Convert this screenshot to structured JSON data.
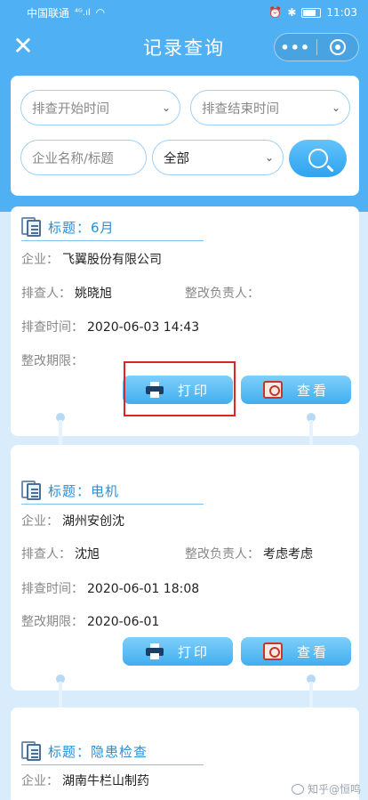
{
  "status_bar": {
    "carrier": "中国联通",
    "signal": "⁴ᴳ.ıl",
    "time": "11:03"
  },
  "nav": {
    "title": "记录查询",
    "close_icon": "close-icon",
    "more_icon": "more-dots-icon",
    "target_icon": "target-icon"
  },
  "filters": {
    "start_time_placeholder": "排查开始时间",
    "end_time_placeholder": "排查结束时间",
    "keyword_placeholder": "企业名称/标题",
    "category_value": "全部",
    "search_icon": "search-icon"
  },
  "labels": {
    "title_prefix": "标题：",
    "company": "企业：",
    "inspector": "排查人：",
    "rectify_owner": "整改负责人：",
    "check_time": "排查时间：",
    "deadline": "整改期限：",
    "print": "打印",
    "view": "查看"
  },
  "records": [
    {
      "title": "6月",
      "company": "飞翼股份有限公司",
      "inspector": "姚晓旭",
      "rectify_owner": "",
      "check_time": "2020-06-03 14:43",
      "deadline": ""
    },
    {
      "title": "电机",
      "company": "湖州安创沈",
      "inspector": "沈旭",
      "rectify_owner": "考虑考虑",
      "check_time": "2020-06-01 18:08",
      "deadline": "2020-06-01"
    },
    {
      "title": "隐患检查",
      "company": "湖南牛栏山制药"
    }
  ],
  "watermark": "知乎@恒鸣",
  "colors": {
    "primary": "#4fb1f4",
    "highlight": "#e02424"
  }
}
